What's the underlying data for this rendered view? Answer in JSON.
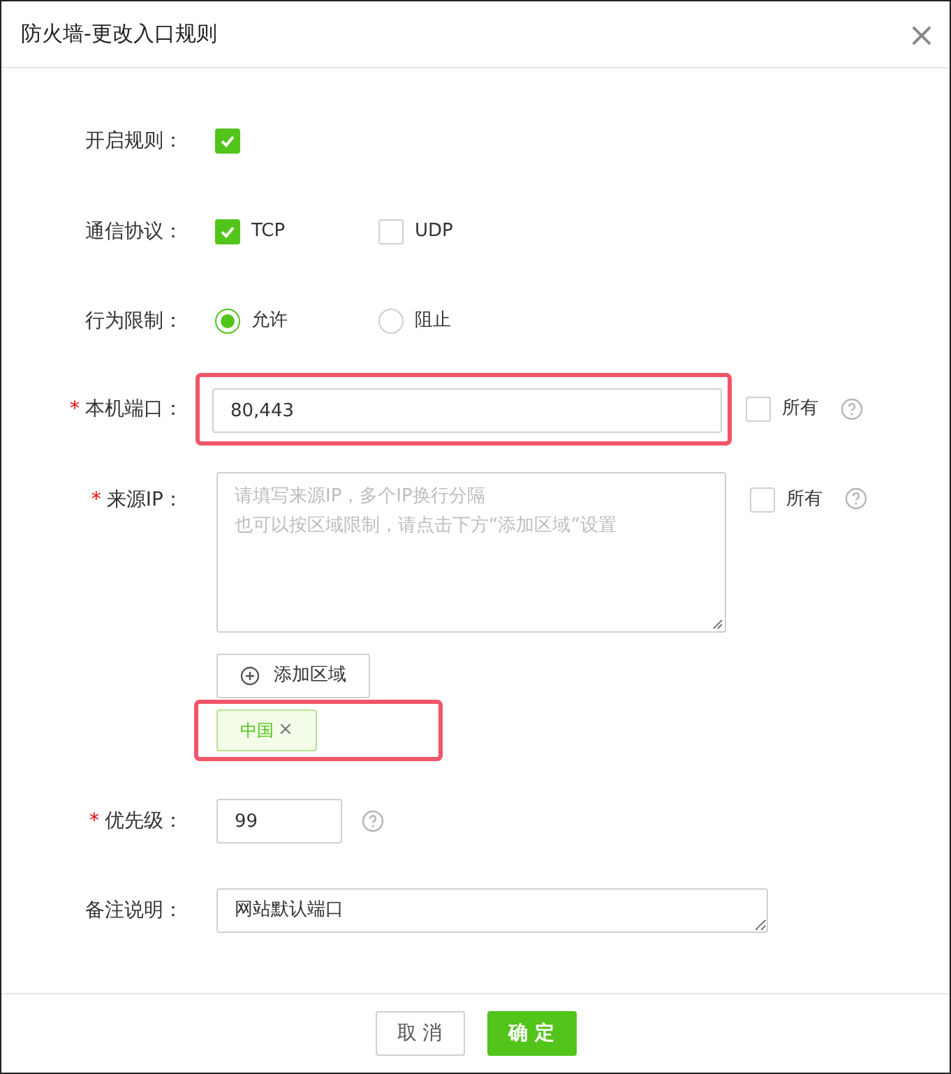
{
  "dialog": {
    "title": "防火墙-更改入口规则",
    "close": "×"
  },
  "enable": {
    "label": "开启规则：",
    "checked": true
  },
  "protocol": {
    "label": "通信协议：",
    "options": [
      {
        "label": "TCP",
        "checked": true
      },
      {
        "label": "UDP",
        "checked": false
      }
    ]
  },
  "action": {
    "label": "行为限制：",
    "options": [
      {
        "label": "允许",
        "selected": true
      },
      {
        "label": "阻止",
        "selected": false
      }
    ]
  },
  "port": {
    "label": "本机端口：",
    "required_mark": "*",
    "value": "80,443",
    "highlighted": true,
    "all": {
      "label": "所有",
      "checked": false
    }
  },
  "source_ip": {
    "label": "来源IP：",
    "required_mark": "*",
    "placeholder_lines": [
      "请填写来源IP，多个IP换行分隔",
      "也可以按区域限制，请点击下方“添加区域”设置"
    ],
    "all": {
      "label": "所有",
      "checked": false
    },
    "add_button": "添加区域",
    "tags_highlighted": true,
    "tags": [
      {
        "label": "中国",
        "remove": "×"
      }
    ]
  },
  "priority": {
    "label": "优先级：",
    "required_mark": "*",
    "value": "99"
  },
  "remark": {
    "label": "备注说明：",
    "value": "网站默认端口"
  },
  "buttons": [
    {
      "label": "取 消",
      "kind": "secondary"
    },
    {
      "label": "确 定",
      "kind": "primary"
    }
  ]
}
